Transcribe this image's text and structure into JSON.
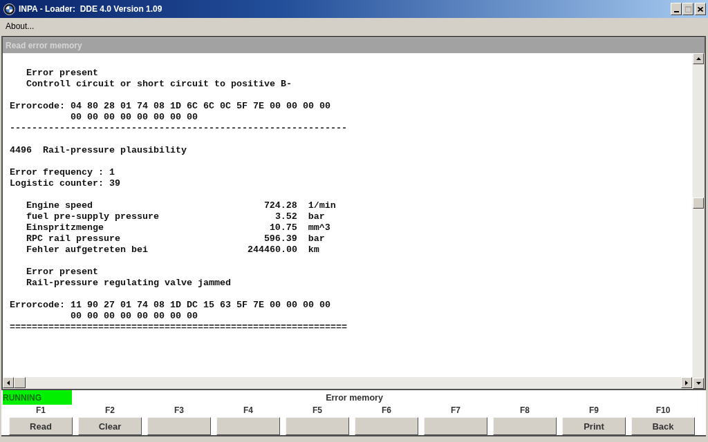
{
  "window": {
    "title": "INPA - Loader:  DDE 4.0 Version 1.09",
    "maximize_enabled": false
  },
  "menu": [
    "About..."
  ],
  "panel": {
    "title": "Read error memory"
  },
  "log": {
    "sections": [
      {
        "lines": [
          {
            "kind": "detail",
            "text": "Error present"
          },
          {
            "kind": "detail",
            "text": "Controll circuit or short circuit to positive B-"
          }
        ]
      },
      {
        "lines": [
          {
            "kind": "errorcode",
            "label": "Errorcode:",
            "bytes": [
              "04 80 28 01 74 08 1D 6C 6C 0C 5F 7E 00 00 00 00",
              "00 00 00 00 00 00 00 00"
            ]
          },
          {
            "kind": "rule",
            "text": "-------------------------------------------------------------"
          }
        ]
      },
      {
        "lines": [
          {
            "kind": "plain",
            "text": "4496  Rail-pressure plausibility"
          }
        ]
      },
      {
        "lines": [
          {
            "kind": "plain",
            "text": "Error frequency : 1"
          },
          {
            "kind": "plain",
            "text": "Logistic counter: 39"
          }
        ]
      },
      {
        "lines": [
          {
            "kind": "param",
            "name": "Engine speed",
            "value": "724.28",
            "unit": "1/min"
          },
          {
            "kind": "param",
            "name": "fuel pre-supply pressure",
            "value": "3.52",
            "unit": "bar"
          },
          {
            "kind": "param",
            "name": "Einspritzmenge",
            "value": "10.75",
            "unit": "mm^3"
          },
          {
            "kind": "param",
            "name": "RPC rail pressure",
            "value": "596.39",
            "unit": "bar"
          },
          {
            "kind": "param",
            "name": "Fehler aufgetreten bei",
            "value": "244460.00",
            "unit": "km"
          }
        ]
      },
      {
        "lines": [
          {
            "kind": "detail",
            "text": "Error present"
          },
          {
            "kind": "detail",
            "text": "Rail-pressure regulating valve jammed"
          }
        ]
      },
      {
        "lines": [
          {
            "kind": "errorcode",
            "label": "Errorcode:",
            "bytes": [
              "11 90 27 01 74 08 1D DC 15 63 5F 7E 00 00 00 00",
              "00 00 00 00 00 00 00 00"
            ]
          },
          {
            "kind": "rule",
            "text": "============================================================="
          }
        ]
      }
    ]
  },
  "status": {
    "label": "RUNNING",
    "kind": "running",
    "title": "Error memory"
  },
  "function_keys": [
    {
      "key": "F1",
      "label": "Read"
    },
    {
      "key": "F2",
      "label": "Clear"
    },
    {
      "key": "F3"
    },
    {
      "key": "F4"
    },
    {
      "key": "F5"
    },
    {
      "key": "F6"
    },
    {
      "key": "F7"
    },
    {
      "key": "F8"
    },
    {
      "key": "F9",
      "label": "Print"
    },
    {
      "key": "F10",
      "label": "Back"
    }
  ]
}
